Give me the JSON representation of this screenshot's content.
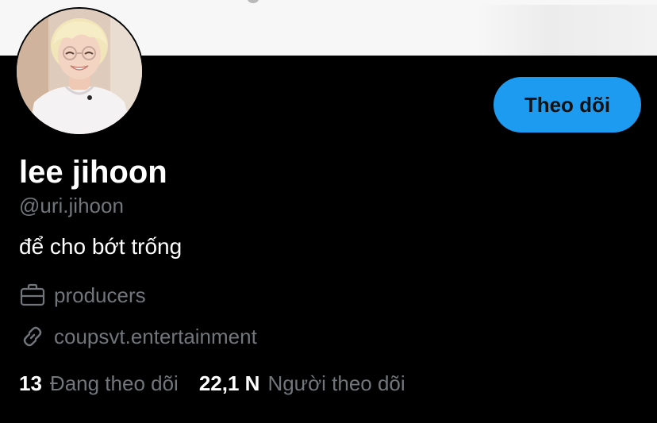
{
  "profile": {
    "display_name": "lee jihoon",
    "handle": "@uri.jihoon",
    "bio": "để cho bớt trống",
    "work": "producers",
    "website": "coupsvt.entertainment"
  },
  "actions": {
    "follow_label": "Theo dõi"
  },
  "stats": {
    "following_count": "13",
    "following_label": "Đang theo dõi",
    "followers_count": "22,1 N",
    "followers_label": "Người theo dõi"
  },
  "icons": {
    "work": "briefcase-icon",
    "website": "link-icon"
  },
  "colors": {
    "background": "#000000",
    "accent": "#1d9bf0",
    "secondary_text": "#71767b",
    "primary_text": "#ffffff"
  }
}
